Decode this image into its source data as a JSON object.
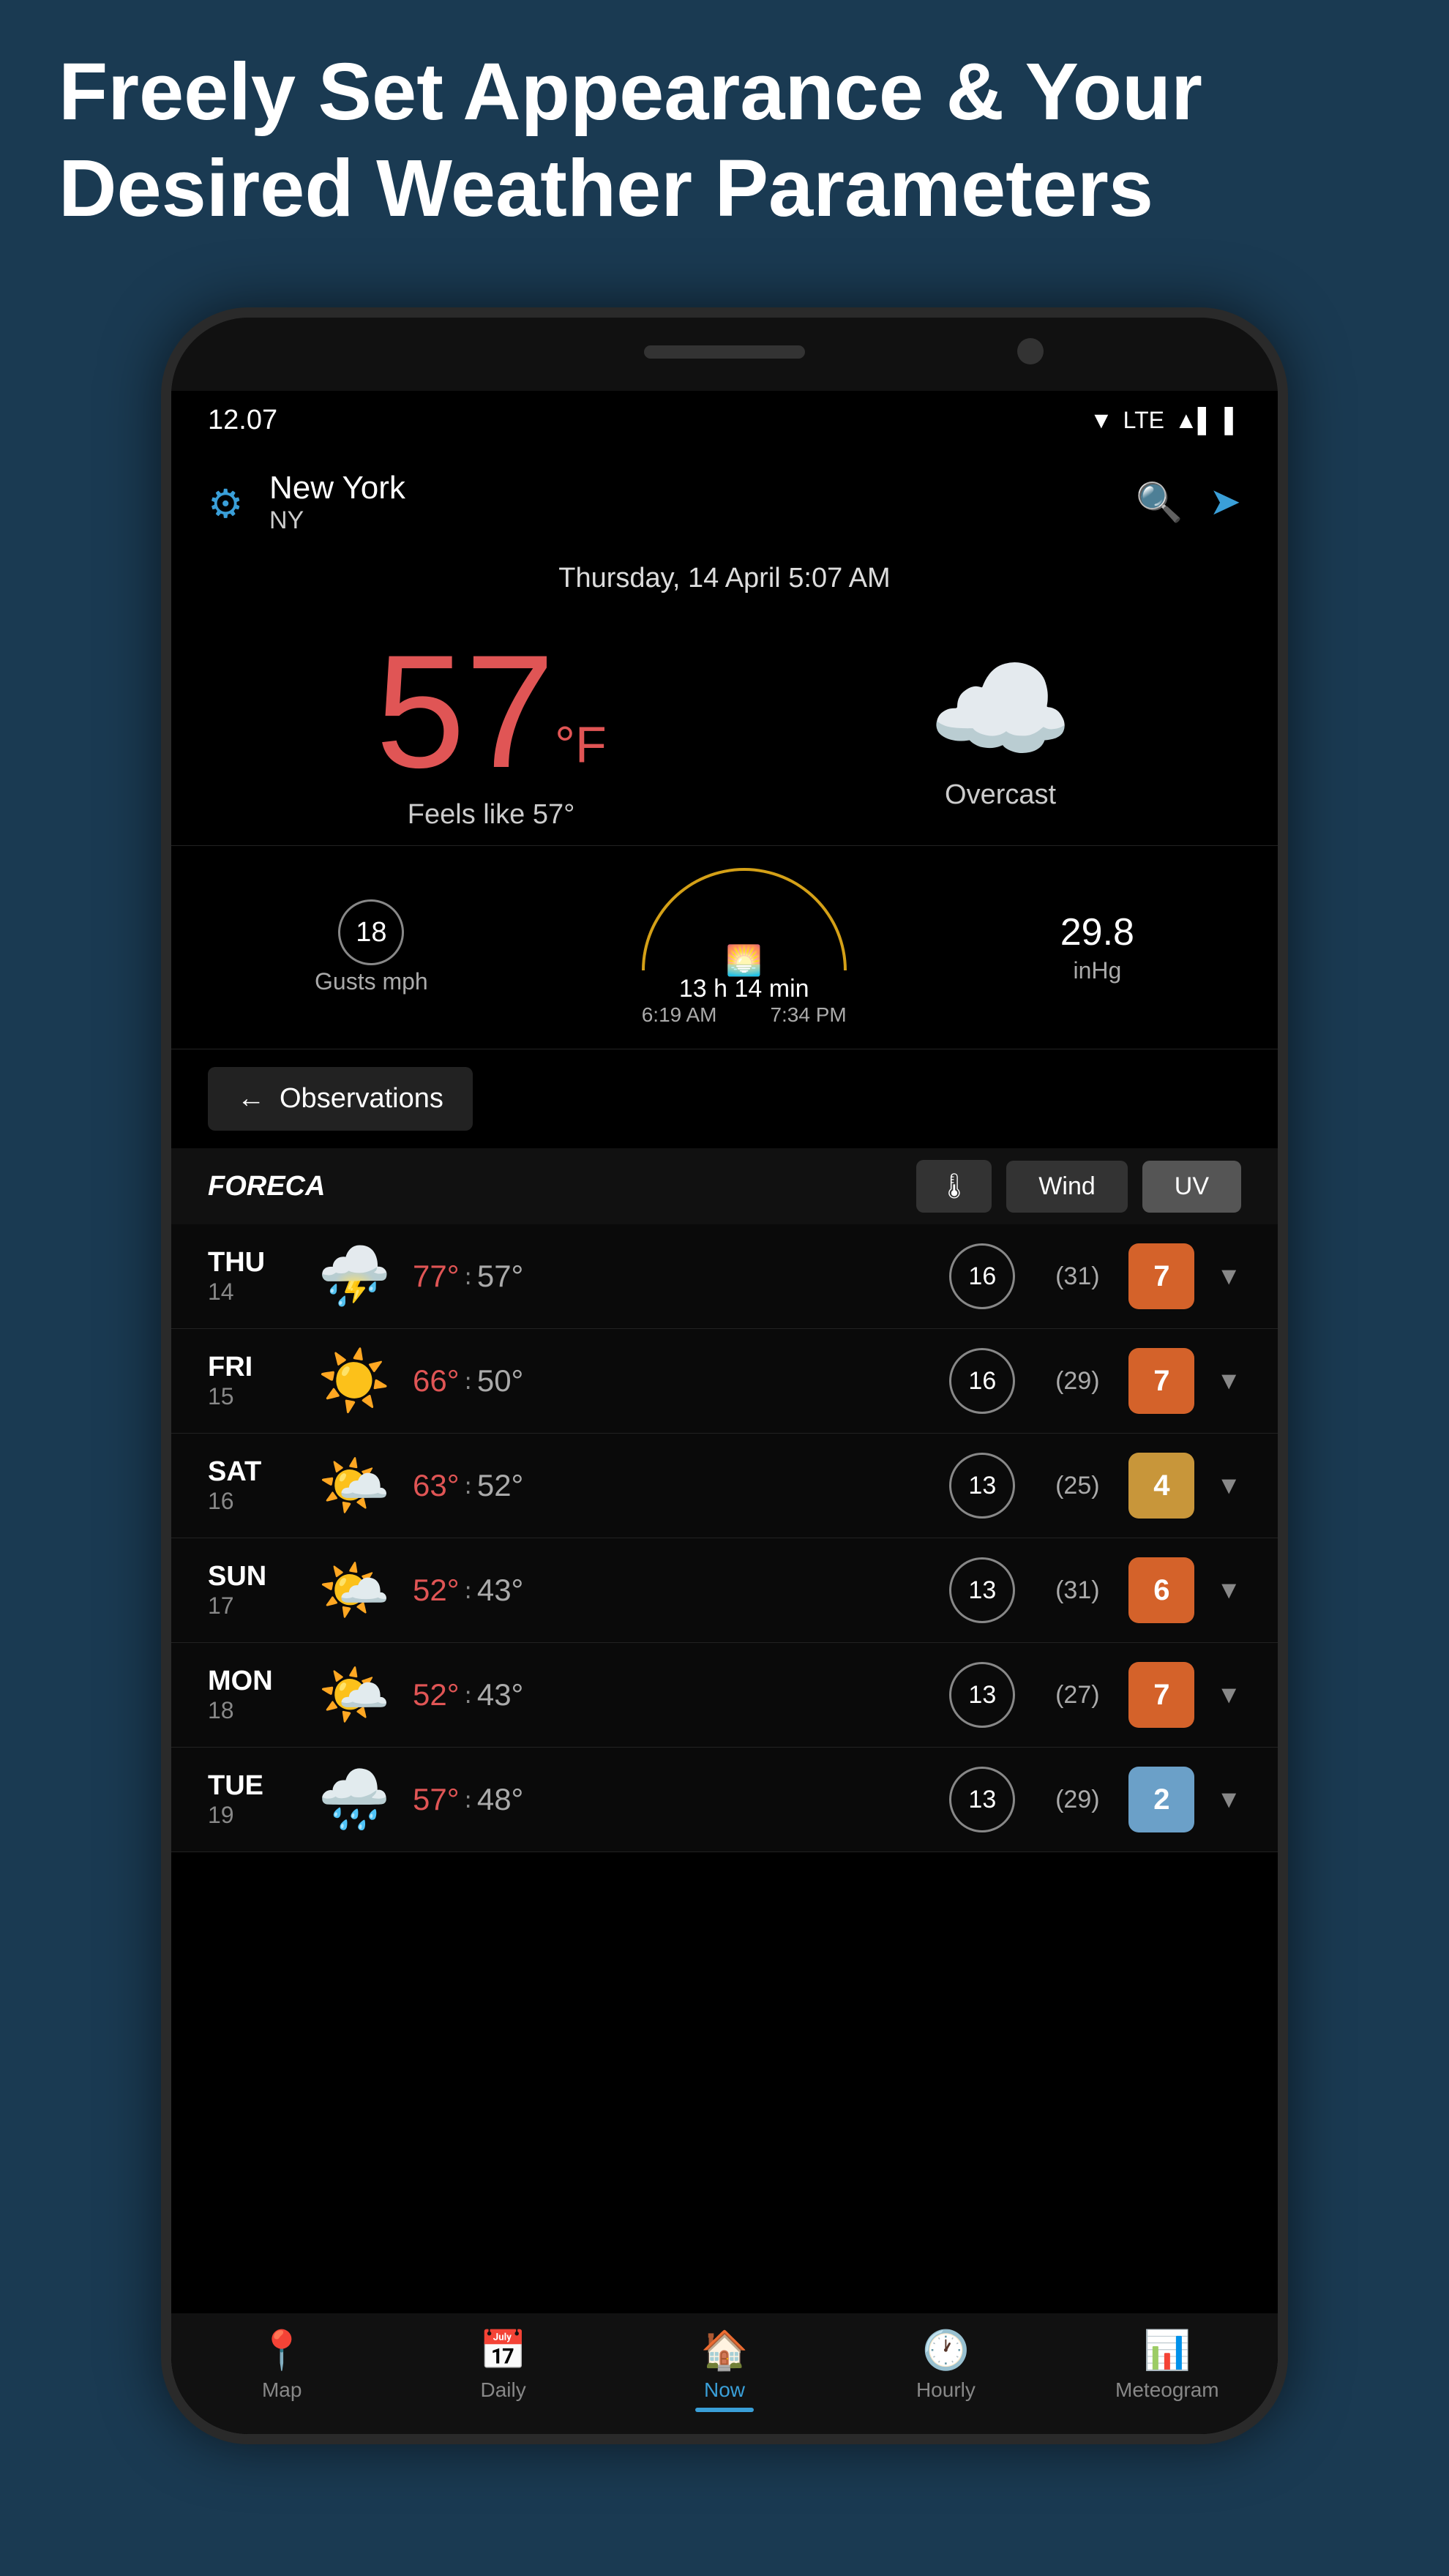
{
  "page": {
    "header_line1": "Freely Set Appearance & Your",
    "header_line2": "Desired Weather Parameters"
  },
  "status_bar": {
    "time": "12.07",
    "lte": "LTE",
    "signal": "▲▌"
  },
  "app_header": {
    "city": "New York",
    "state": "NY"
  },
  "weather": {
    "date": "Thursday, 14 April 5:07 AM",
    "temperature": "57",
    "unit": "°F",
    "feels_like": "Feels like 57°",
    "description": "Overcast",
    "gusts_value": "18",
    "gusts_label": "Gusts mph",
    "sun_duration": "13 h 14 min",
    "sunrise": "6:19 AM",
    "sunset": "7:34 PM",
    "pressure_value": "29.8",
    "pressure_unit": "inHg"
  },
  "observations_btn": {
    "label": "Observations"
  },
  "tabs": {
    "foreca": "FORECA",
    "thermometer": "🌡",
    "wind": "Wind",
    "uv": "UV"
  },
  "forecast": [
    {
      "day": "THU",
      "date": "14",
      "icon": "⛈️",
      "temp_high": "77°",
      "temp_low": "57°",
      "wind": "16",
      "gust": "(31)",
      "uv": "7",
      "uv_class": "uv-high"
    },
    {
      "day": "FRI",
      "date": "15",
      "icon": "☀️",
      "temp_high": "66°",
      "temp_low": "50°",
      "wind": "16",
      "gust": "(29)",
      "uv": "7",
      "uv_class": "uv-high"
    },
    {
      "day": "SAT",
      "date": "16",
      "icon": "🌤️",
      "temp_high": "63°",
      "temp_low": "52°",
      "wind": "13",
      "gust": "(25)",
      "uv": "4",
      "uv_class": "uv-moderate"
    },
    {
      "day": "SUN",
      "date": "17",
      "icon": "🌤️",
      "temp_high": "52°",
      "temp_low": "43°",
      "wind": "13",
      "gust": "(31)",
      "uv": "6",
      "uv_class": "uv-high"
    },
    {
      "day": "MON",
      "date": "18",
      "icon": "🌤️",
      "temp_high": "52°",
      "temp_low": "43°",
      "wind": "13",
      "gust": "(27)",
      "uv": "7",
      "uv_class": "uv-high"
    },
    {
      "day": "TUE",
      "date": "19",
      "icon": "🌧️",
      "temp_high": "57°",
      "temp_low": "48°",
      "wind": "13",
      "gust": "(29)",
      "uv": "2",
      "uv_class": "uv-low"
    }
  ],
  "bottom_nav": [
    {
      "id": "map",
      "icon": "📍",
      "label": "Map",
      "active": false
    },
    {
      "id": "daily",
      "icon": "📅",
      "label": "Daily",
      "active": false
    },
    {
      "id": "now",
      "icon": "🏠",
      "label": "Now",
      "active": true
    },
    {
      "id": "hourly",
      "icon": "🕐",
      "label": "Hourly",
      "active": false
    },
    {
      "id": "meteogram",
      "icon": "📊",
      "label": "Meteogram",
      "active": false
    }
  ]
}
